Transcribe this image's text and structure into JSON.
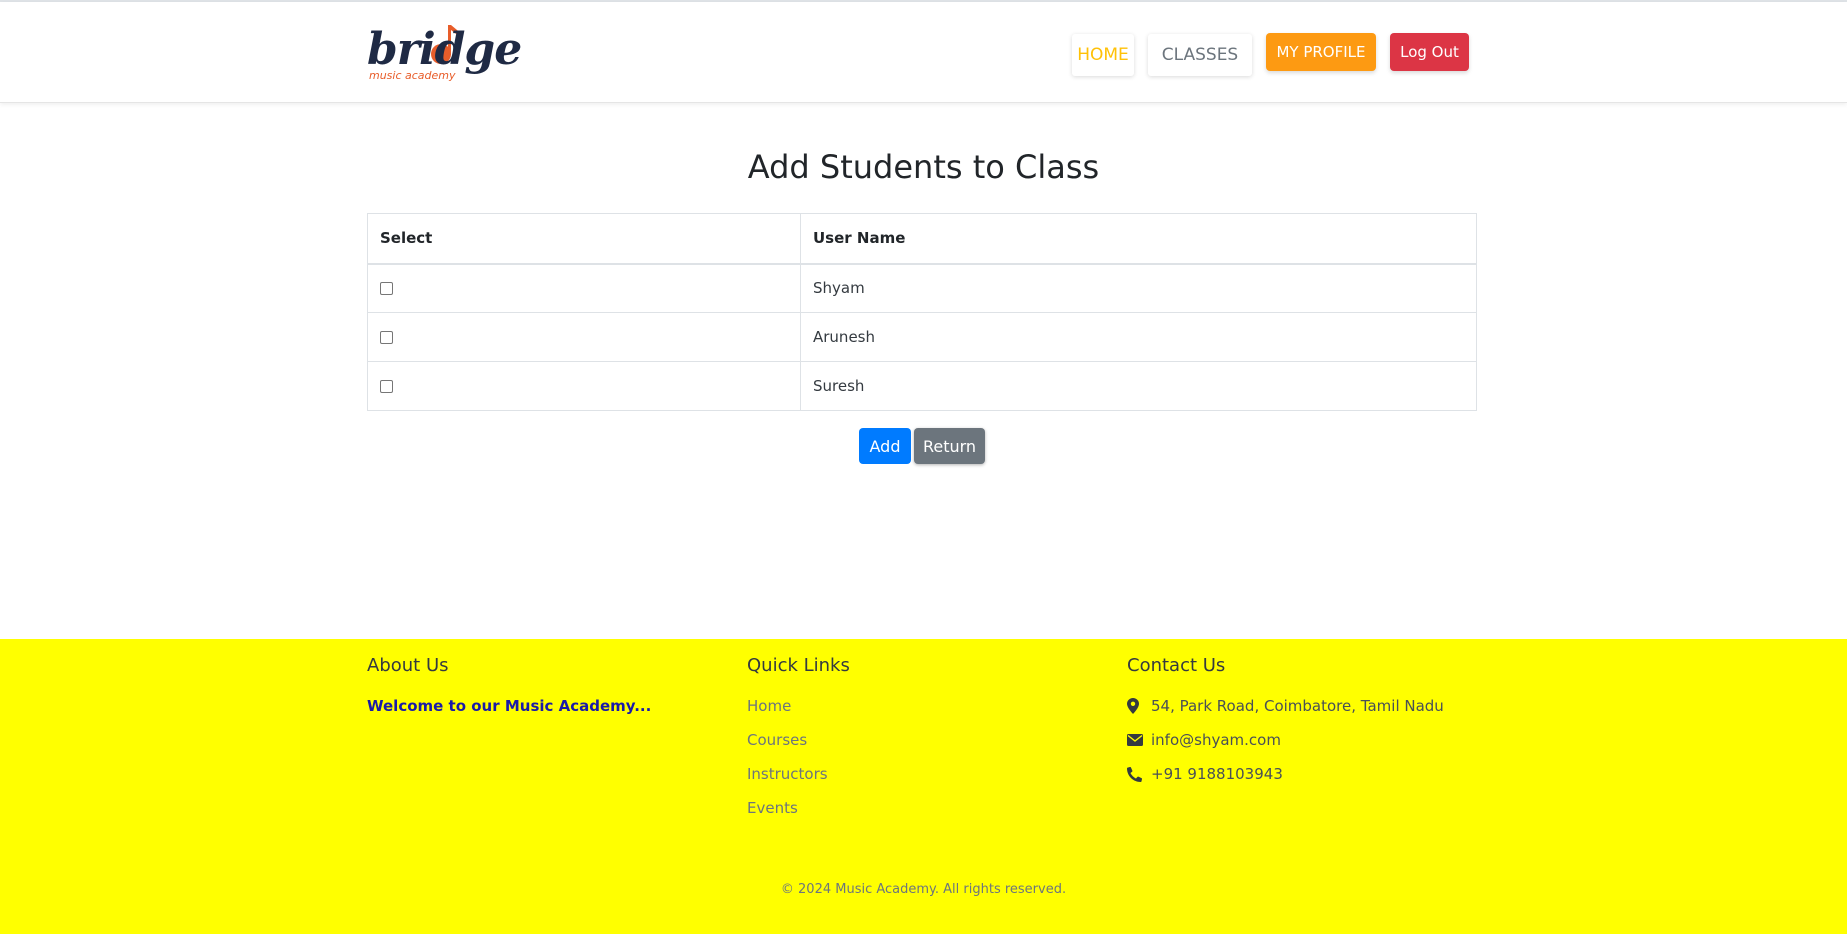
{
  "header": {
    "logo_text": "bridge",
    "logo_subtext": "music academy",
    "nav": {
      "home": "HOME",
      "classes": "CLASSES",
      "my_profile": "MY PROFILE",
      "logout": "Log Out"
    }
  },
  "main": {
    "title": "Add Students to Class",
    "table": {
      "columns": [
        "Select",
        "User Name"
      ],
      "rows": [
        {
          "selected": false,
          "user_name": "Shyam"
        },
        {
          "selected": false,
          "user_name": "Arunesh"
        },
        {
          "selected": false,
          "user_name": "Suresh"
        }
      ]
    },
    "buttons": {
      "add": "Add",
      "return": "Return"
    }
  },
  "footer": {
    "about": {
      "heading": "About Us",
      "text": "Welcome to our  Music Academy..."
    },
    "quick_links": {
      "heading": "Quick Links",
      "items": [
        "Home",
        "Courses",
        "Instructors",
        "Events"
      ]
    },
    "contact": {
      "heading": "Contact Us",
      "address": "54, Park Road, Coimbatore, Tamil Nadu",
      "email": "info@shyam.com",
      "phone": "+91 9188103943"
    },
    "copyright": "© 2024  Music Academy. All rights reserved."
  },
  "colors": {
    "footer_bg": "#ffff00",
    "home_link": "#ffc107",
    "profile_button": "#fd9a12",
    "logout_button": "#dc3545",
    "add_button": "#007bff",
    "return_button": "#6c757d",
    "about_text": "#1a1aa8"
  },
  "icons": {
    "address": "map-marker-icon",
    "email": "envelope-icon",
    "phone": "phone-icon",
    "logo_note": "music-note-icon"
  }
}
